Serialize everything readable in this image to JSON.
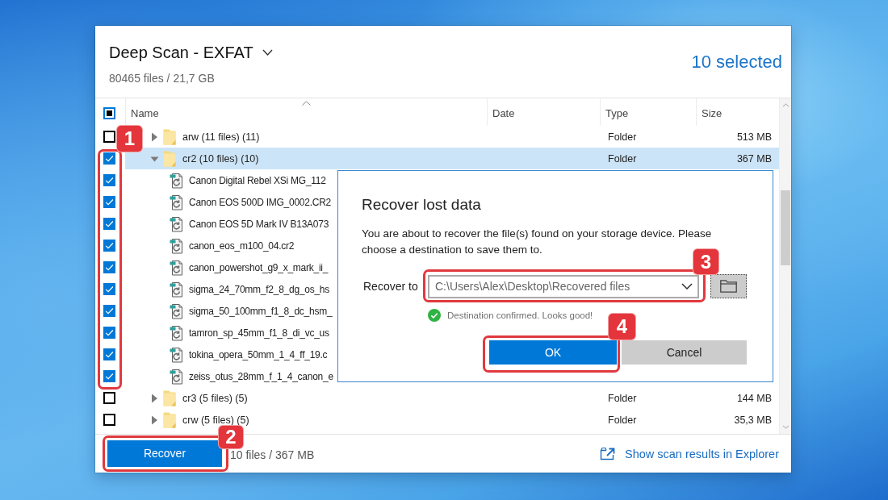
{
  "header": {
    "title": "Deep Scan - EXFAT",
    "subtitle": "80465 files / 21,7 GB",
    "selection_count": "10 selected"
  },
  "table": {
    "select_all": {
      "partial": true
    },
    "columns": [
      {
        "label": "Name",
        "sorted": true
      },
      {
        "label": "Date",
        "sorted": false
      },
      {
        "label": "Type",
        "sorted": false
      },
      {
        "label": "Size",
        "sorted": false
      }
    ],
    "rows": [
      {
        "kind": "folder",
        "name": "arw (11 files) (11)",
        "type": "Folder",
        "size": "513 MB",
        "checked": false,
        "expanded": false,
        "selected": false
      },
      {
        "kind": "folder",
        "name": "cr2 (10 files) (10)",
        "type": "Folder",
        "size": "367 MB",
        "checked": true,
        "expanded": true,
        "selected": true,
        "children": [
          {
            "kind": "file",
            "name": "Canon Digital Rebel XSi MG_112",
            "checked": true,
            "selected": false
          },
          {
            "kind": "file",
            "name": "Canon EOS 500D IMG_0002.CR2",
            "checked": true,
            "selected": false
          },
          {
            "kind": "file",
            "name": "Canon EOS 5D Mark IV B13A073",
            "checked": true,
            "selected": false
          },
          {
            "kind": "file",
            "name": "canon_eos_m100_04.cr2",
            "checked": true,
            "selected": false
          },
          {
            "kind": "file",
            "name": "canon_powershot_g9_x_mark_ii_",
            "checked": true,
            "selected": false
          },
          {
            "kind": "file",
            "name": "sigma_24_70mm_f2_8_dg_os_hs",
            "checked": true,
            "selected": false
          },
          {
            "kind": "file",
            "name": "sigma_50_100mm_f1_8_dc_hsm_",
            "checked": true,
            "selected": false
          },
          {
            "kind": "file",
            "name": "tamron_sp_45mm_f1_8_di_vc_us",
            "checked": true,
            "selected": false
          },
          {
            "kind": "file",
            "name": "tokina_opera_50mm_1_4_ff_19.c",
            "checked": true,
            "selected": false
          },
          {
            "kind": "file",
            "name": "zeiss_otus_28mm_f_1_4_canon_e",
            "checked": true,
            "selected": false
          }
        ]
      },
      {
        "kind": "folder",
        "name": "cr3 (5 files) (5)",
        "type": "Folder",
        "size": "144 MB",
        "checked": false,
        "expanded": false,
        "selected": false
      },
      {
        "kind": "folder",
        "name": "crw (5 files) (5)",
        "type": "Folder",
        "size": "35,3 MB",
        "checked": false,
        "expanded": false,
        "selected": false
      }
    ]
  },
  "footer": {
    "recover_button": "Recover",
    "summary": "10 files / 367 MB",
    "explorer_link": "Show scan results in Explorer"
  },
  "dialog": {
    "title": "Recover lost data",
    "message": "You are about to recover the file(s) found on your storage device. Please choose a destination to save them to.",
    "destination": {
      "label": "Recover to",
      "value": "C:\\Users\\Alex\\Desktop\\Recovered files"
    },
    "status": "Destination confirmed. Looks good!",
    "buttons": [
      {
        "label": "OK",
        "kind": "primary"
      },
      {
        "label": "Cancel",
        "kind": "secondary"
      }
    ]
  },
  "annotations": [
    {
      "number": "1"
    },
    {
      "number": "2"
    },
    {
      "number": "3"
    },
    {
      "number": "4"
    }
  ]
}
